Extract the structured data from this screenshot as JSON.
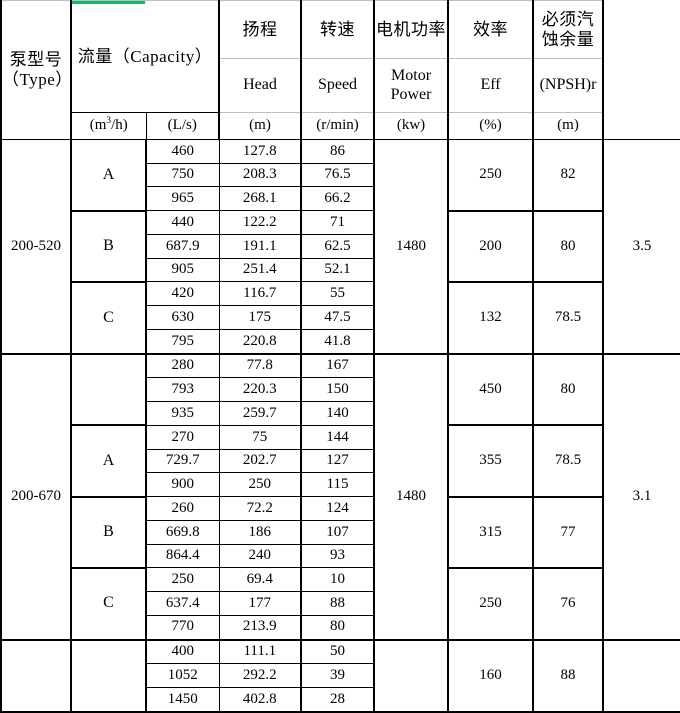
{
  "accent_color": "#16b866",
  "header": {
    "type_cn_en": "泵型号（Type）",
    "capacity_cn_en": "流量（Capacity）",
    "columns": [
      {
        "cn": "扬程",
        "en": "Head",
        "unit": "(m)"
      },
      {
        "cn": "转速",
        "en": "Speed",
        "unit": "(r/min)"
      },
      {
        "cn": "电机功率",
        "en": "Motor Power",
        "unit": "(kw)"
      },
      {
        "cn": "效率",
        "en": "Eff",
        "unit": "(%)"
      },
      {
        "cn": "必须汽蚀余量",
        "en": "(NPSH)r",
        "unit": "(m)"
      }
    ],
    "capacity_units": [
      "(m³/h)",
      "(L/s)"
    ]
  },
  "table": {
    "sections": [
      {
        "type": "200-520",
        "speed": "1480",
        "npshr": "3.5",
        "groups": [
          {
            "grade": "A",
            "power": "250",
            "eff": "82",
            "rows": [
              {
                "q_m3h": "460",
                "q_ls": "127.8",
                "head": "86"
              },
              {
                "q_m3h": "750",
                "q_ls": "208.3",
                "head": "76.5"
              },
              {
                "q_m3h": "965",
                "q_ls": "268.1",
                "head": "66.2"
              }
            ]
          },
          {
            "grade": "B",
            "power": "200",
            "eff": "80",
            "rows": [
              {
                "q_m3h": "440",
                "q_ls": "122.2",
                "head": "71"
              },
              {
                "q_m3h": "687.9",
                "q_ls": "191.1",
                "head": "62.5"
              },
              {
                "q_m3h": "905",
                "q_ls": "251.4",
                "head": "52.1"
              }
            ]
          },
          {
            "grade": "C",
            "power": "132",
            "eff": "78.5",
            "rows": [
              {
                "q_m3h": "420",
                "q_ls": "116.7",
                "head": "55"
              },
              {
                "q_m3h": "630",
                "q_ls": "175",
                "head": "47.5"
              },
              {
                "q_m3h": "795",
                "q_ls": "220.8",
                "head": "41.8"
              }
            ]
          }
        ]
      },
      {
        "type": "200-670",
        "speed": "1480",
        "npshr": "3.1",
        "groups": [
          {
            "grade": "",
            "power": "450",
            "eff": "80",
            "rows": [
              {
                "q_m3h": "280",
                "q_ls": "77.8",
                "head": "167"
              },
              {
                "q_m3h": "793",
                "q_ls": "220.3",
                "head": "150"
              },
              {
                "q_m3h": "935",
                "q_ls": "259.7",
                "head": "140"
              }
            ]
          },
          {
            "grade": "A",
            "power": "355",
            "eff": "78.5",
            "rows": [
              {
                "q_m3h": "270",
                "q_ls": "75",
                "head": "144"
              },
              {
                "q_m3h": "729.7",
                "q_ls": "202.7",
                "head": "127"
              },
              {
                "q_m3h": "900",
                "q_ls": "250",
                "head": "115"
              }
            ]
          },
          {
            "grade": "B",
            "power": "315",
            "eff": "77",
            "rows": [
              {
                "q_m3h": "260",
                "q_ls": "72.2",
                "head": "124"
              },
              {
                "q_m3h": "669.8",
                "q_ls": "186",
                "head": "107"
              },
              {
                "q_m3h": "864.4",
                "q_ls": "240",
                "head": "93"
              }
            ]
          },
          {
            "grade": "C",
            "power": "250",
            "eff": "76",
            "rows": [
              {
                "q_m3h": "250",
                "q_ls": "69.4",
                "head": "10"
              },
              {
                "q_m3h": "637.4",
                "q_ls": "177",
                "head": "88"
              },
              {
                "q_m3h": "770",
                "q_ls": "213.9",
                "head": "80"
              }
            ]
          }
        ]
      },
      {
        "type": "",
        "speed": "",
        "npshr": "",
        "groups": [
          {
            "grade": "",
            "power": "160",
            "eff": "88",
            "rows": [
              {
                "q_m3h": "400",
                "q_ls": "111.1",
                "head": "50"
              },
              {
                "q_m3h": "1052",
                "q_ls": "292.2",
                "head": "39"
              },
              {
                "q_m3h": "1450",
                "q_ls": "402.8",
                "head": "28"
              }
            ]
          }
        ]
      }
    ]
  }
}
